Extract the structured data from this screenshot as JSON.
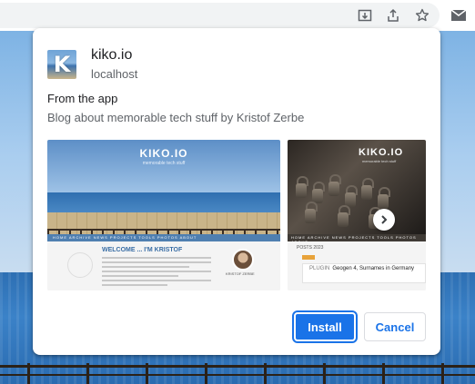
{
  "browser": {
    "icons": [
      "install-app-icon",
      "share-icon",
      "star-icon",
      "gmail-icon"
    ]
  },
  "dialog": {
    "app_icon_letter": "K",
    "app_name": "kiko.io",
    "origin": "localhost",
    "from_label": "From the app",
    "description": "Blog about memorable tech stuff by Kristof Zerbe",
    "screenshots": [
      {
        "site_title": "KIKO.IO",
        "site_subtitle": "memorable tech stuff",
        "nav": "HOME  ARCHIVE  NEWS  PROJECTS  TOOLS  PHOTOS  ABOUT",
        "welcome": "WELCOME ... I'M KRISTOF",
        "author_name": "KRISTOF ZERBE"
      },
      {
        "site_title": "KIKO.IO",
        "site_subtitle": "memorable tech stuff",
        "nav": "HOME  ARCHIVE  NEWS  PROJECTS  TOOLS  PHOTOS  ABOUT",
        "posts_label": "POSTS 2023",
        "post_category": "PLUGIN",
        "post_title": "Geogen 4, Surnames in Germany"
      }
    ],
    "next_icon": "chevron-right-icon",
    "install_label": "Install",
    "cancel_label": "Cancel",
    "accent_color": "#1a73e8"
  }
}
